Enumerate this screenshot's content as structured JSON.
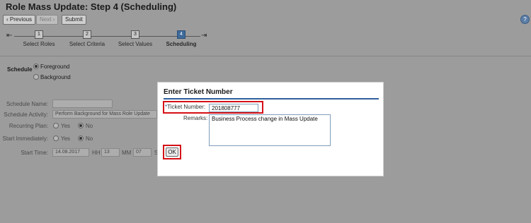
{
  "page": {
    "title": "Role Mass Update: Step 4  (Scheduling)"
  },
  "toolbar": {
    "previous": "Previous",
    "next": "Next",
    "submit": "Submit",
    "help_icon": "?"
  },
  "wizard": {
    "steps": [
      {
        "number": "1",
        "label": "Select Roles"
      },
      {
        "number": "2",
        "label": "Select Criteria"
      },
      {
        "number": "3",
        "label": "Select Values"
      },
      {
        "number": "4",
        "label": "Scheduling"
      }
    ]
  },
  "form": {
    "schedule_label": "Schedule",
    "foreground": "Foreground",
    "background": "Background",
    "schedule_name_label": "Schedule Name:",
    "schedule_activity_label": "Schedule Activity:",
    "schedule_activity_value": "Perform Background for Mass Role Update",
    "recurring_plan_label": "Recurring Plan:",
    "start_immediately_label": "Start Immediately:",
    "yes": "Yes",
    "no": "No",
    "start_time_label": "Start Time:",
    "date": "14.08.2017",
    "hh_label": "HH",
    "hh": "13",
    "mm_label": "MM",
    "mm": "07",
    "ss_label": "S"
  },
  "dialog": {
    "title": "Enter Ticket Number",
    "ticket_label": "Ticket Number:",
    "ticket_value": "201808777",
    "remarks_label": "Remarks:",
    "remarks_value": "Business Process change in Mass Update",
    "ok": "OK"
  },
  "colors": {
    "dialog_rule": "#2f5f9c",
    "highlight": "#d51016",
    "active_step": "#3e6a9a"
  }
}
